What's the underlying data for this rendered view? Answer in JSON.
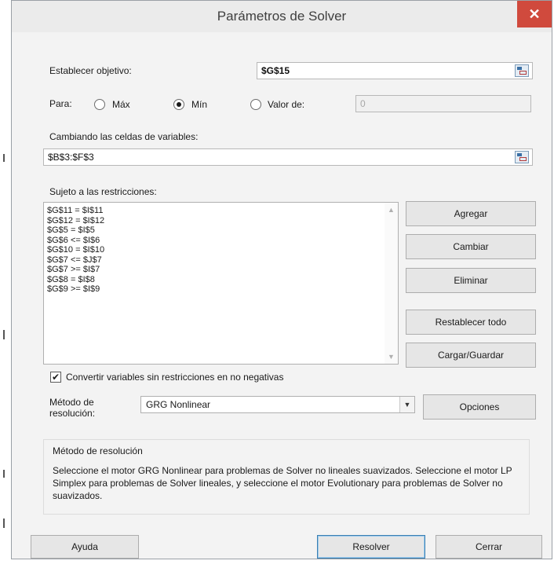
{
  "window": {
    "title": "Parámetros de Solver",
    "close_glyph": "✕"
  },
  "objective": {
    "label": "Establecer objetivo:",
    "value": "$G$15",
    "picker_icon": "range-select-icon"
  },
  "to": {
    "label": "Para:",
    "options": [
      {
        "label": "Máx",
        "selected": false
      },
      {
        "label": "Mín",
        "selected": true
      },
      {
        "label": "Valor de:",
        "selected": false
      }
    ],
    "value_of": "0"
  },
  "variables": {
    "label": "Cambiando las celdas de variables:",
    "value": "$B$3:$F$3"
  },
  "constraints": {
    "label": "Sujeto a las restricciones:",
    "items": [
      "$G$11 = $I$11",
      "$G$12 = $I$12",
      "$G$5 = $I$5",
      "$G$6 <= $I$6",
      "$G$10 = $I$10",
      "$G$7 <= $J$7",
      "$G$7 >= $I$7",
      "$G$8 = $I$8",
      "$G$9 >= $I$9"
    ],
    "buttons": {
      "add": "Agregar",
      "change": "Cambiar",
      "delete": "Eliminar",
      "reset": "Restablecer todo",
      "load_save": "Cargar/Guardar"
    }
  },
  "nonneg": {
    "label": "Convertir variables sin restricciones en no negativas",
    "checked": true
  },
  "method": {
    "label": "Método de resolución:",
    "value": "GRG Nonlinear",
    "options_button": "Opciones"
  },
  "method_group": {
    "title": "Método de resolución",
    "text": "Seleccione el motor GRG Nonlinear para problemas de Solver no lineales suavizados. Seleccione el motor LP Simplex para problemas de Solver lineales, y seleccione el motor Evolutionary para problemas de Solver no suavizados."
  },
  "footer": {
    "help": "Ayuda",
    "solve": "Resolver",
    "close": "Cerrar"
  },
  "colors": {
    "close_button": "#d04a3d",
    "default_button_border": "#3c7fb1",
    "dialog_bg": "#f3f3f3"
  }
}
